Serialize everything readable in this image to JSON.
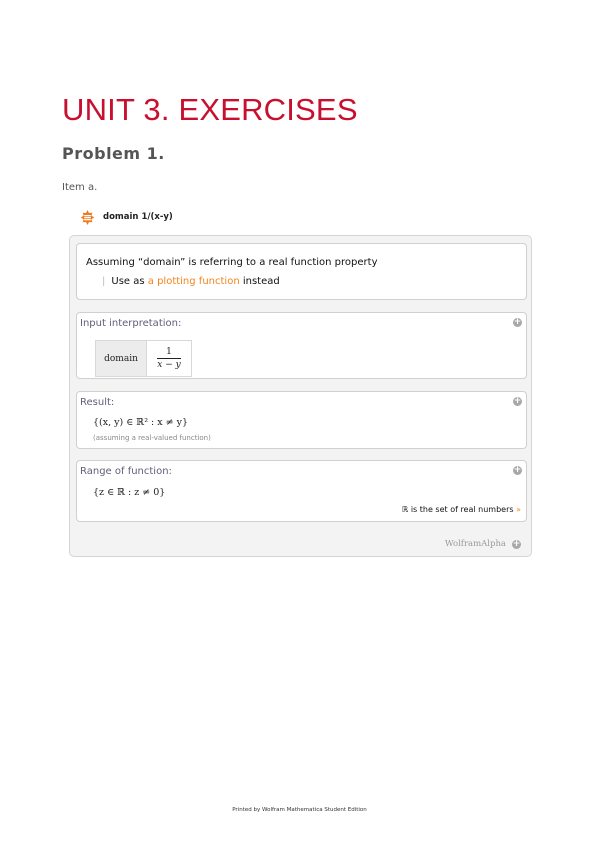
{
  "title": "UNIT 3. EXERCISES",
  "subtitle": "Problem 1.",
  "item_label": "Item a.",
  "query": {
    "icon": "wolfram-alpha-spikey-icon",
    "text": "domain 1/(x-y)"
  },
  "assumption": {
    "line1": "Assuming “domain” is  referring to a real function property",
    "bar": "|",
    "use_as": "Use as",
    "link": "a plotting function",
    "instead": "instead"
  },
  "pods": {
    "input": {
      "title": "Input interpretation:",
      "domain_label": "domain",
      "numerator": "1",
      "denominator": "x − y"
    },
    "result": {
      "title": "Result:",
      "math": "{(x, y) ∈ ℝ² : x ≠ y}",
      "note": "(assuming a real-valued function)"
    },
    "range": {
      "title": "Range of function:",
      "math": "{z ∈ ℝ : z ≠ 0}",
      "note": "ℝ is the set of real numbers",
      "arrow": "»"
    }
  },
  "wolfram_label": "WolframAlpha",
  "plus_symbol": "+",
  "footer": "Printed by Wolfram Mathematica Student Edition",
  "colors": {
    "title": "#c8102e",
    "link": "#f2841b",
    "pod_title": "#5f5f7a"
  }
}
